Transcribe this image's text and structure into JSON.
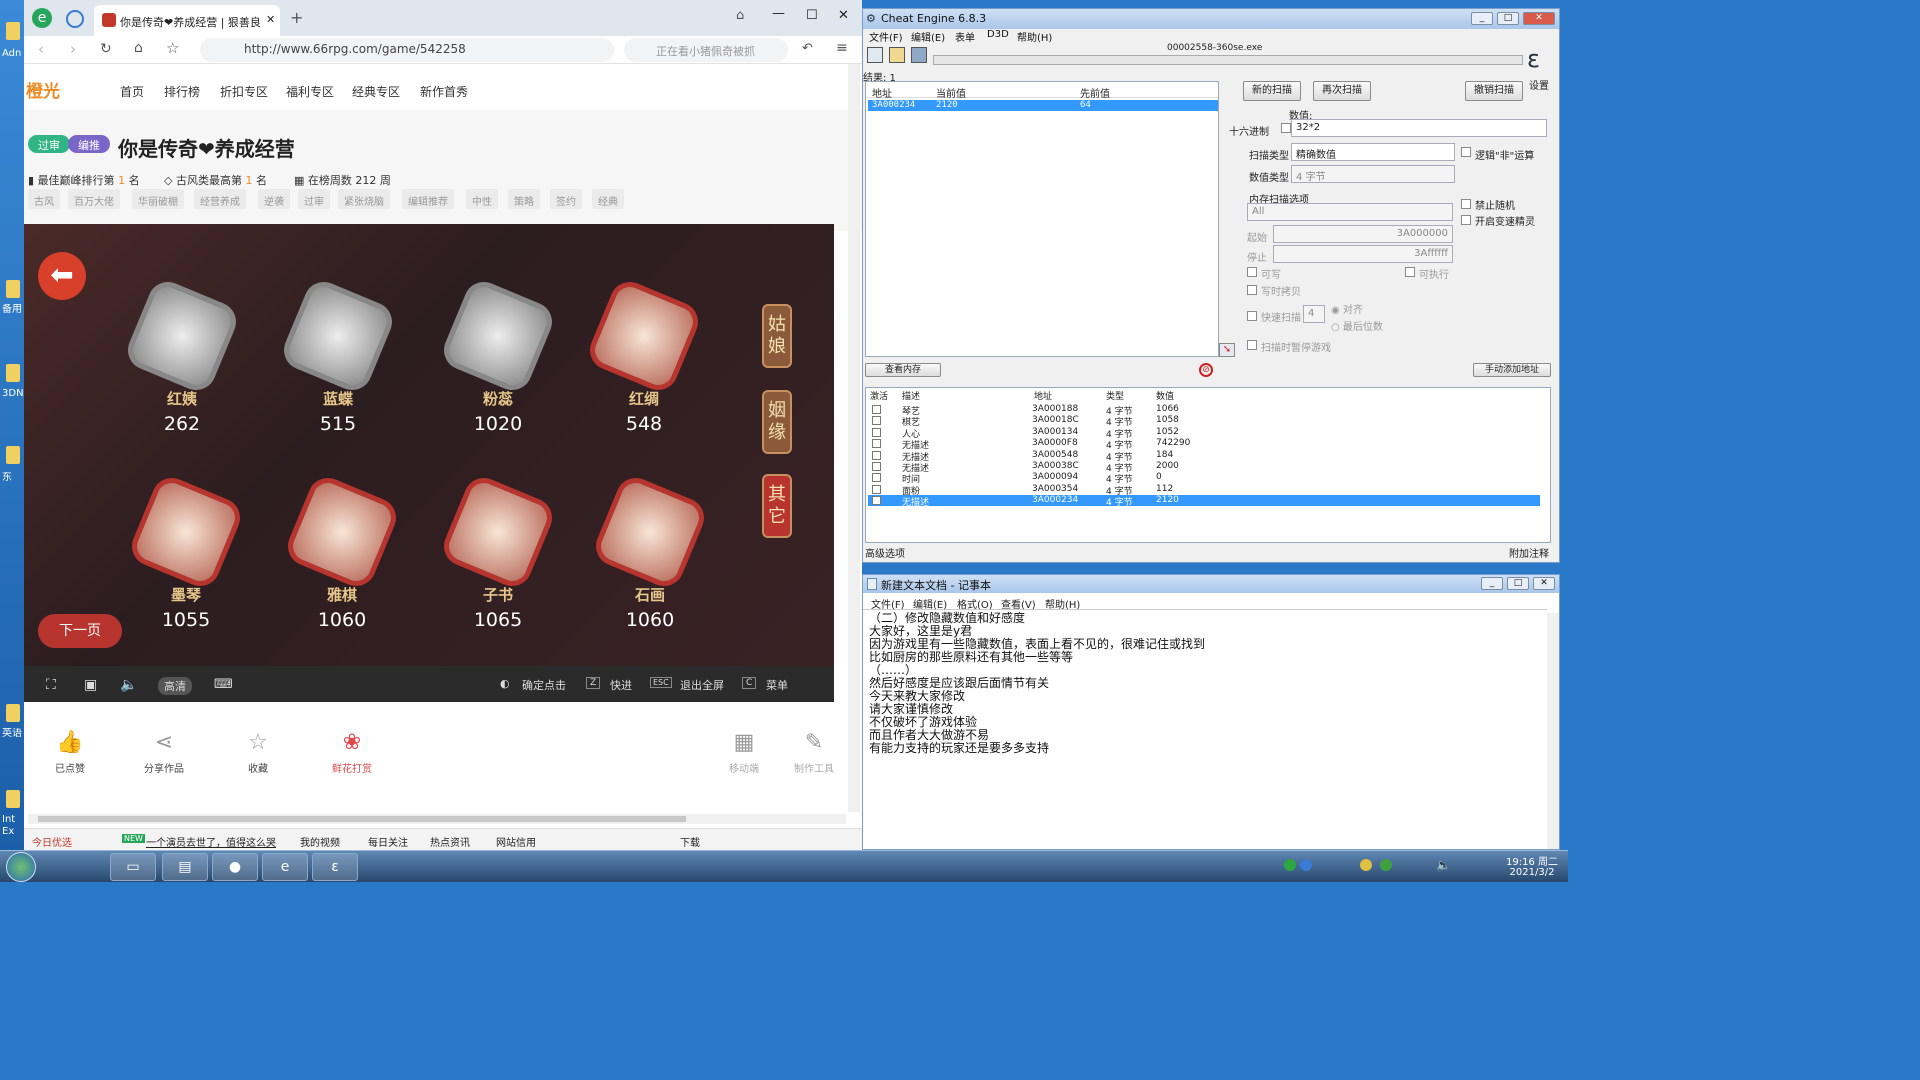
{
  "desktop": {
    "icons": [
      "Adn",
      "备用",
      "3DN",
      "东",
      "英语",
      "Int Ex"
    ]
  },
  "browser": {
    "tab_title": "你是传奇❤养成经营 | 狠善良",
    "url": "http://www.66rpg.com/game/542258",
    "search_placeholder": "正在看小猪佩奇被抓",
    "site_logo": "橙光",
    "nav": [
      "首页",
      "排行榜",
      "折扣专区",
      "福利专区",
      "经典专区",
      "新作首秀"
    ],
    "badges": [
      "过审",
      "编推"
    ],
    "game_title": "你是传奇❤养成经营",
    "meta": {
      "rank": "最佳巅峰排行第",
      "rank_num": "1",
      "rank_unit": "名",
      "style": "古风类最高第",
      "style_num": "1",
      "style_unit": "名",
      "weeks": "在榜周数 212 周"
    },
    "tags": [
      "古风",
      "百万大佬",
      "华丽破棚",
      "经营养成",
      "逆袭",
      "过审",
      "紧张烧脑",
      "编辑推荐",
      "中性",
      "策略",
      "签约",
      "经典"
    ],
    "characters": [
      {
        "name": "红姨",
        "value": "262"
      },
      {
        "name": "蓝蝶",
        "value": "515"
      },
      {
        "name": "粉蕊",
        "value": "1020"
      },
      {
        "name": "红绸",
        "value": "548"
      },
      {
        "name": "墨琴",
        "value": "1055"
      },
      {
        "name": "雅棋",
        "value": "1060"
      },
      {
        "name": "子书",
        "value": "1065"
      },
      {
        "name": "石画",
        "value": "1060"
      }
    ],
    "side_buttons": [
      "姑娘",
      "姻缘",
      "其它"
    ],
    "next_page": "下一页",
    "game_bar": {
      "quality": "高清",
      "confirm": "确定点击",
      "fast": "快进",
      "exit": "退出全屏",
      "menu": "菜单",
      "key_z": "Z",
      "key_esc": "ESC",
      "key_c": "C"
    },
    "actions": [
      "已点赞",
      "分享作品",
      "收藏",
      "鲜花打赏",
      "移动端",
      "制作工具"
    ],
    "status": [
      "今日优选",
      "NEW",
      "一个演员去世了，值得这么哭",
      "我的视频",
      "每日关注",
      "热点资讯",
      "网站信用",
      "下载"
    ]
  },
  "ce": {
    "title": "Cheat Engine 6.8.3",
    "menu": [
      "文件(F)",
      "编辑(E)",
      "表单",
      "D3D",
      "帮助(H)"
    ],
    "process": "00002558-360se.exe",
    "results": "结果: 1",
    "result_headers": [
      "地址",
      "当前值",
      "先前值"
    ],
    "result_row": [
      "3A000234",
      "2120",
      "64"
    ],
    "buttons": {
      "new_scan": "新的扫描",
      "next_scan": "再次扫描",
      "undo_scan": "撤销扫描",
      "settings": "设置",
      "view_mem": "查看内存",
      "add_manual": "手动添加地址",
      "advanced": "高级选项",
      "add_note": "附加注释"
    },
    "value_label": "数值:",
    "hex_label": "十六进制",
    "value": "32*2",
    "scan_type_label": "扫描类型",
    "scan_type": "精确数值",
    "value_type_label": "数值类型",
    "value_type": "4 字节",
    "not_op": "逻辑\"非\"运算",
    "mem_opts": "内存扫描选项",
    "mem_all": "All",
    "start_label": "起始",
    "start": "3A000000",
    "stop_label": "停止",
    "stop": "3Affffff",
    "writable": "可写",
    "executable": "可执行",
    "copy_on_write": "写时拷贝",
    "fast_scan": "快速扫描",
    "fast_val": "4",
    "align": "对齐",
    "last_digits": "最后位数",
    "pause": "扫描时暂停游戏",
    "no_random": "禁止随机",
    "speedhack": "开启变速精灵",
    "table_headers": [
      "激活",
      "描述",
      "地址",
      "类型",
      "数值"
    ],
    "table": [
      {
        "desc": "琴艺",
        "addr": "3A000188",
        "type": "4 字节",
        "val": "1066"
      },
      {
        "desc": "棋艺",
        "addr": "3A00018C",
        "type": "4 字节",
        "val": "1058"
      },
      {
        "desc": "人心",
        "addr": "3A000134",
        "type": "4 字节",
        "val": "1052"
      },
      {
        "desc": "无描述",
        "addr": "3A0000F8",
        "type": "4 字节",
        "val": "742290"
      },
      {
        "desc": "无描述",
        "addr": "3A000548",
        "type": "4 字节",
        "val": "184"
      },
      {
        "desc": "无描述",
        "addr": "3A00038C",
        "type": "4 字节",
        "val": "2000"
      },
      {
        "desc": "时间",
        "addr": "3A000094",
        "type": "4 字节",
        "val": "0"
      },
      {
        "desc": "面粉",
        "addr": "3A000354",
        "type": "4 字节",
        "val": "112"
      },
      {
        "desc": "无描述",
        "addr": "3A000234",
        "type": "4 字节",
        "val": "2120"
      }
    ]
  },
  "notepad": {
    "title": "新建文本文档 - 记事本",
    "menu": [
      "文件(F)",
      "编辑(E)",
      "格式(O)",
      "查看(V)",
      "帮助(H)"
    ],
    "lines": [
      "（二）修改隐藏数值和好感度",
      "大家好，这里是y君",
      "因为游戏里有一些隐藏数值，表面上看不见的，很难记住或找到",
      "比如厨房的那些原料还有其他一些等等",
      "（……）",
      "然后好感度是应该跟后面情节有关",
      "今天来教大家修改",
      "请大家谨慎修改",
      "不仅破坏了游戏体验",
      "而且作者大大做游不易",
      "有能力支持的玩家还是要多多支持"
    ]
  },
  "taskbar": {
    "time": "19:16 周二",
    "date": "2021/3/2"
  }
}
